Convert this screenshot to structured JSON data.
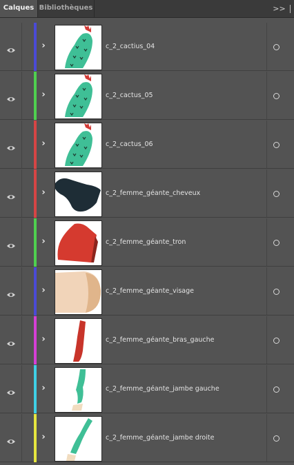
{
  "tabs": {
    "active_label": "Calques",
    "inactive_label": "Bibliothèques",
    "menu_glyph": ">>"
  },
  "layers": [
    {
      "name": "c_2_cactius_04",
      "color": "#4a4ad6",
      "thumb": "cactus"
    },
    {
      "name": "c_2_cactus_05",
      "color": "#4fd04f",
      "thumb": "cactus"
    },
    {
      "name": "c_2_cactus_06",
      "color": "#d64545",
      "thumb": "cactus"
    },
    {
      "name": "c_2_femme_géante_cheveux",
      "color": "#d64545",
      "thumb": "hair"
    },
    {
      "name": "c_2_femme_géante_tron",
      "color": "#4fd04f",
      "thumb": "torso"
    },
    {
      "name": "c_2_femme_géante_visage",
      "color": "#4a4ad6",
      "thumb": "face"
    },
    {
      "name": "c_2_femme_géante_bras_gauche",
      "color": "#d63fd6",
      "thumb": "arm"
    },
    {
      "name": "c_2_femme_géante_jambe gauche",
      "color": "#3fd0e6",
      "thumb": "leg_left"
    },
    {
      "name": "c_2_femme_géante_jambe droite",
      "color": "#e6e63f",
      "thumb": "leg_right"
    }
  ]
}
